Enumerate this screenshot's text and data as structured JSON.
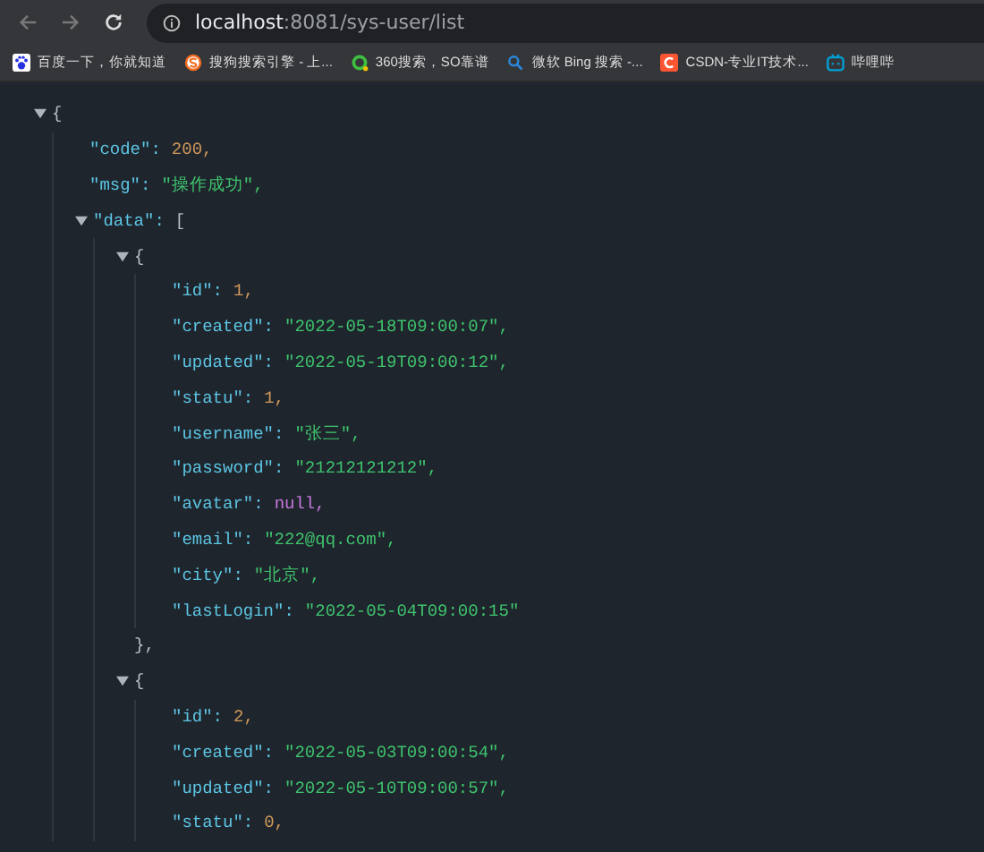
{
  "toolbar": {
    "url_host": "localhost",
    "url_path": ":8081/sys-user/list"
  },
  "bookmarks": [
    {
      "label": "百度一下，你就知道"
    },
    {
      "label": "搜狗搜索引擎 - 上..."
    },
    {
      "label": "360搜索，SO靠谱"
    },
    {
      "label": "微软 Bing 搜索 -..."
    },
    {
      "label": "CSDN-专业IT技术..."
    },
    {
      "label": "哔哩哔"
    }
  ],
  "json_viewer": {
    "root": {
      "kind": "container",
      "open": "{",
      "expanded": true,
      "children": [
        {
          "kind": "entry",
          "key": "\"code\":",
          "value": {
            "kind": "number",
            "text": "200,"
          }
        },
        {
          "kind": "entry",
          "key": "\"msg\":",
          "value": {
            "kind": "string",
            "text": "\"操作成功\","
          }
        },
        {
          "kind": "container",
          "key": "\"data\":",
          "open": "[",
          "expanded": true,
          "children": [
            {
              "kind": "container",
              "open": "{",
              "expanded": true,
              "close": "},",
              "children": [
                {
                  "kind": "entry",
                  "key": "\"id\":",
                  "value": {
                    "kind": "number",
                    "text": "1,"
                  }
                },
                {
                  "kind": "entry",
                  "key": "\"created\":",
                  "value": {
                    "kind": "string",
                    "text": "\"2022-05-18T09:00:07\","
                  }
                },
                {
                  "kind": "entry",
                  "key": "\"updated\":",
                  "value": {
                    "kind": "string",
                    "text": "\"2022-05-19T09:00:12\","
                  }
                },
                {
                  "kind": "entry",
                  "key": "\"statu\":",
                  "value": {
                    "kind": "number",
                    "text": "1,"
                  }
                },
                {
                  "kind": "entry",
                  "key": "\"username\":",
                  "value": {
                    "kind": "string",
                    "text": "\"张三\","
                  }
                },
                {
                  "kind": "entry",
                  "key": "\"password\":",
                  "value": {
                    "kind": "string",
                    "text": "\"21212121212\","
                  }
                },
                {
                  "kind": "entry",
                  "key": "\"avatar\":",
                  "value": {
                    "kind": "null",
                    "text": "null,"
                  }
                },
                {
                  "kind": "entry",
                  "key": "\"email\":",
                  "value": {
                    "kind": "string",
                    "text": "\"222@qq.com\","
                  }
                },
                {
                  "kind": "entry",
                  "key": "\"city\":",
                  "value": {
                    "kind": "string",
                    "text": "\"北京\","
                  }
                },
                {
                  "kind": "entry",
                  "key": "\"lastLogin\":",
                  "value": {
                    "kind": "string",
                    "text": "\"2022-05-04T09:00:15\""
                  }
                }
              ]
            },
            {
              "kind": "container",
              "open": "{",
              "expanded": true,
              "children": [
                {
                  "kind": "entry",
                  "key": "\"id\":",
                  "value": {
                    "kind": "number",
                    "text": "2,"
                  }
                },
                {
                  "kind": "entry",
                  "key": "\"created\":",
                  "value": {
                    "kind": "string",
                    "text": "\"2022-05-03T09:00:54\","
                  }
                },
                {
                  "kind": "entry",
                  "key": "\"updated\":",
                  "value": {
                    "kind": "string",
                    "text": "\"2022-05-10T09:00:57\","
                  }
                },
                {
                  "kind": "entry",
                  "key": "\"statu\":",
                  "value": {
                    "kind": "number",
                    "text": "0,"
                  }
                }
              ]
            }
          ]
        }
      ]
    }
  }
}
